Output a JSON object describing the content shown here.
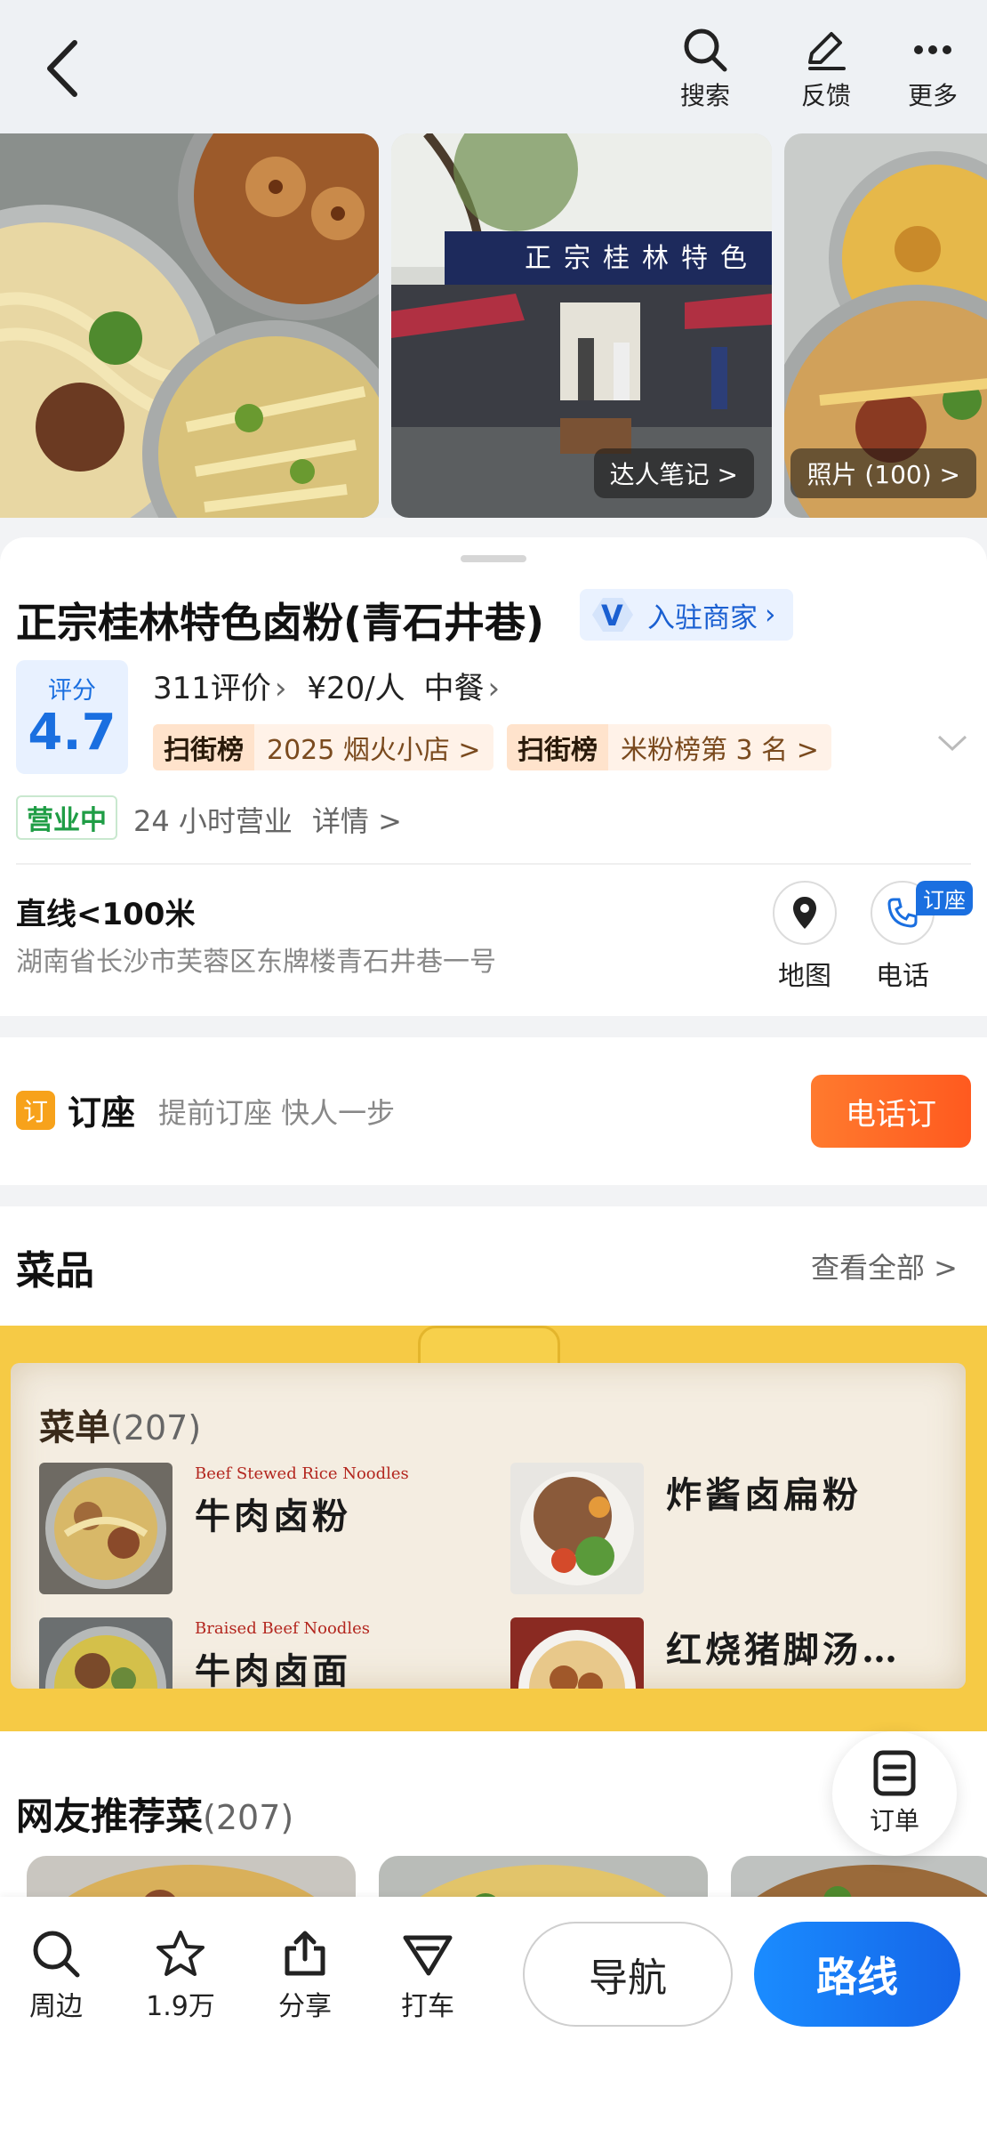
{
  "top_bar": {
    "actions": [
      {
        "icon": "search-icon",
        "label": "搜索"
      },
      {
        "icon": "feedback-icon",
        "label": "反馈"
      },
      {
        "icon": "more-icon",
        "label": "更多"
      }
    ]
  },
  "photos": {
    "tags": [
      "达人笔记 >",
      "照片 (100) >"
    ],
    "storefront_sign": "正宗桂林特色"
  },
  "shop": {
    "name": "正宗桂林特色卤粉(青石井巷)",
    "merchant_badge": "入驻商家",
    "score_label": "评分",
    "score": "4.7",
    "reviews": "311评价",
    "price": "¥20/人",
    "category": "中餐",
    "ranks": [
      {
        "logo": "扫街榜",
        "text": "2025 烟火小店 >"
      },
      {
        "logo": "扫街榜",
        "text": "米粉榜第 3 名 >"
      }
    ],
    "status": "营业中",
    "hours": "24 小时营业",
    "details": "详情 >",
    "distance": "直线<100米",
    "address": "湖南省长沙市芙蓉区东牌楼青石井巷一号",
    "map_label": "地图",
    "phone_label": "电话",
    "seat_flag": "订座"
  },
  "booking": {
    "icon_char": "订",
    "title": "订座",
    "subtitle": "提前订座 快人一步",
    "button": "电话订"
  },
  "dishes": {
    "title": "菜品",
    "see_all": "查看全部 >",
    "menu_label": "菜单",
    "menu_count": "(207)",
    "menu_items": [
      {
        "en": "Beef Stewed Rice Noodles",
        "cn": "牛肉卤粉"
      },
      {
        "en": "",
        "cn": "炸酱卤扁粉"
      },
      {
        "en": "Braised Beef Noodles",
        "cn": "牛肉卤面"
      },
      {
        "en": "",
        "cn": "红烧猪脚汤…"
      }
    ],
    "recommend_title": "网友推荐菜",
    "recommend_count": "(207)"
  },
  "order_fab": {
    "label": "订单"
  },
  "bottom_bar": {
    "items": [
      {
        "icon": "nearby-search-icon",
        "label": "周边"
      },
      {
        "icon": "star-icon",
        "label": "1.9万"
      },
      {
        "icon": "share-icon",
        "label": "分享"
      },
      {
        "icon": "taxi-icon",
        "label": "打车"
      }
    ],
    "nav_button": "导航",
    "route_button": "路线"
  },
  "colors": {
    "accent_blue": "#1a6fe0",
    "open_green": "#1f9d45",
    "book_orange": "#ff5a1f",
    "menu_yellow": "#f6ca45"
  }
}
